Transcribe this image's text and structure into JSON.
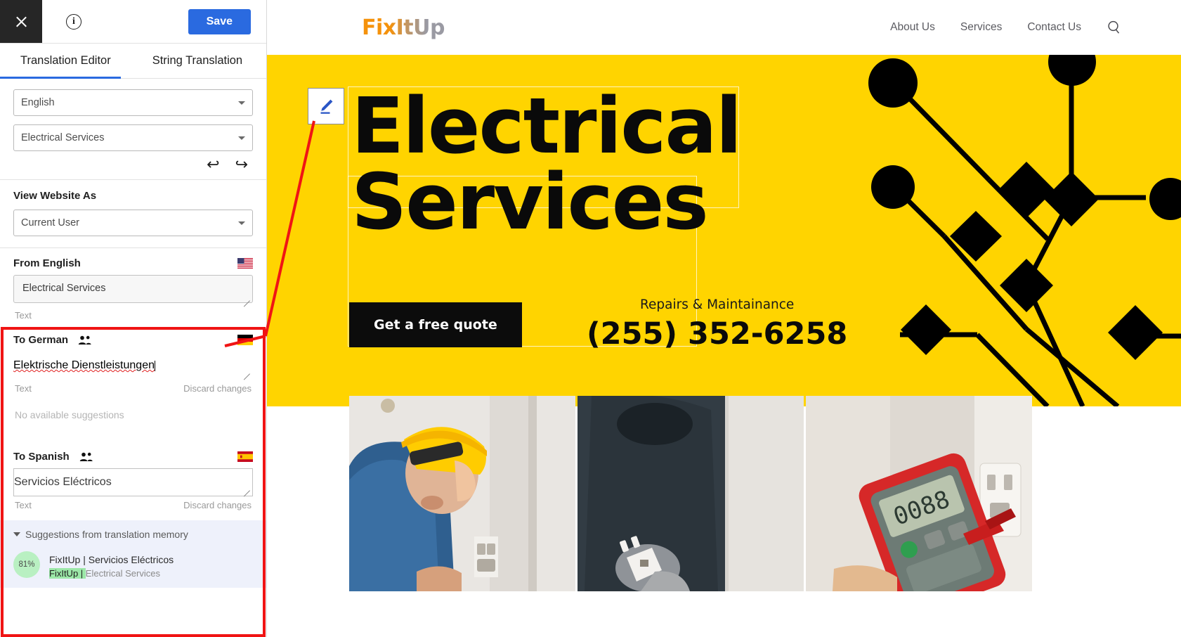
{
  "sidebar": {
    "topbar": {
      "close_label": "",
      "close_icon": "close-icon",
      "info_icon": "info-circle-icon",
      "info_label": "i",
      "save_label": "Save"
    },
    "tabs": [
      {
        "label": "Translation Editor",
        "active": true
      },
      {
        "label": "String Translation",
        "active": false
      }
    ],
    "selectors": {
      "language": "English",
      "string": "Electrical Services"
    },
    "history": {
      "undo_icon": "undo-arrow-icon",
      "undo_glyph": "↩",
      "redo_icon": "redo-arrow-icon",
      "redo_glyph": "↪"
    },
    "view_as": {
      "title": "View Website As",
      "value": "Current User"
    },
    "source": {
      "title": "From English",
      "flag_icon": "flag-us-icon",
      "value": "Electrical Services",
      "meta_label": "Text"
    },
    "targets": [
      {
        "title": "To German",
        "people_icon": "people-icon",
        "flag_icon": "flag-de-icon",
        "value": "Elektrische Dienstleistungen",
        "meta_label": "Text",
        "discard_label": "Discard changes",
        "suggestions_empty": "No available suggestions"
      },
      {
        "title": "To Spanish",
        "people_icon": "people-icon",
        "flag_icon": "flag-es-icon",
        "value": "Servicios Eléctricos",
        "meta_label": "Text",
        "discard_label": "Discard changes"
      }
    ],
    "translation_memory": {
      "header": "Suggestions from translation memory",
      "items": [
        {
          "score": "81%",
          "target": "FixItUp | Servicios Eléctricos",
          "source_prefix": "FixItUp | ",
          "source_rest": "Electrical Services"
        }
      ]
    }
  },
  "site": {
    "logo": "FixItUp",
    "nav": [
      {
        "label": "About Us"
      },
      {
        "label": "Services"
      },
      {
        "label": "Contact Us"
      }
    ],
    "search_icon": "search-icon",
    "hero": {
      "edit_icon": "pencil-edit-icon",
      "title_line1": "Electrical",
      "title_line2": "Services",
      "cta_label": "Get a free quote",
      "contact_sub": "Repairs & Maintainance",
      "contact_phone": "(255) 352-6258"
    },
    "photos": [
      {
        "name": "electrician-hardhat-photo"
      },
      {
        "name": "electrician-plug-photo"
      },
      {
        "name": "multimeter-outlet-photo"
      }
    ]
  },
  "colors": {
    "accent_blue": "#2a6ae0",
    "hero_yellow": "#ffd400",
    "highlight_red": "#f01414",
    "tm_panel": "#eef1fb",
    "score_green": "#b9f0c2"
  }
}
